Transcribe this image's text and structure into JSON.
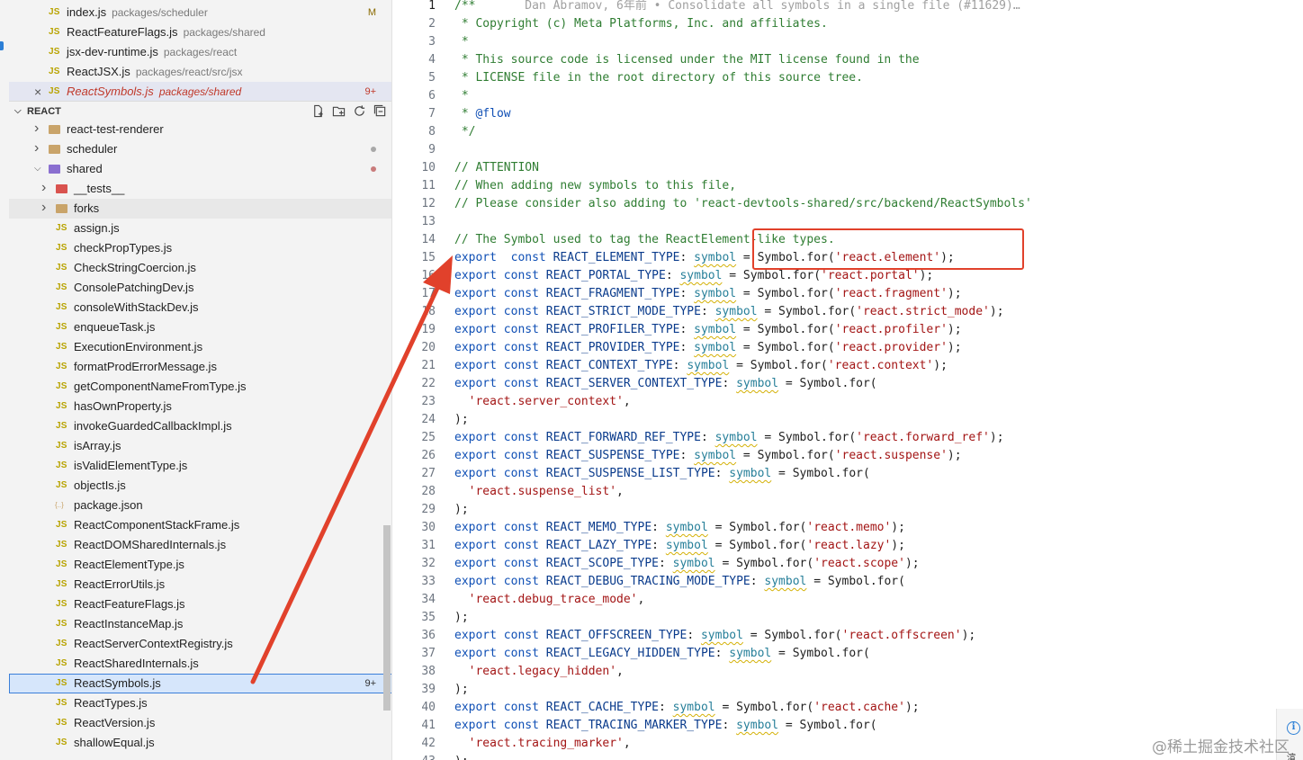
{
  "open_editors": [
    {
      "name": "index.js",
      "path": "packages/scheduler",
      "badge": "M",
      "close": false,
      "active": false
    },
    {
      "name": "ReactFeatureFlags.js",
      "path": "packages/shared",
      "badge": "",
      "close": false,
      "active": false
    },
    {
      "name": "jsx-dev-runtime.js",
      "path": "packages/react",
      "badge": "",
      "close": false,
      "active": false
    },
    {
      "name": "ReactJSX.js",
      "path": "packages/react/src/jsx",
      "badge": "",
      "close": false,
      "active": false
    },
    {
      "name": "ReactSymbols.js",
      "path": "packages/shared",
      "badge": "9+",
      "close": true,
      "active": true
    }
  ],
  "explorer": {
    "section_title": "REACT",
    "close_glyph": "×",
    "file_type_label": "JS",
    "json_type_label": "{..}",
    "folders": [
      {
        "name": "react-test-renderer",
        "expanded": false,
        "status": ""
      },
      {
        "name": "scheduler",
        "expanded": false,
        "status": "gray"
      },
      {
        "name": "shared",
        "expanded": true,
        "status": "rose"
      }
    ],
    "subfolders": [
      {
        "name": "__tests__"
      },
      {
        "name": "forks"
      }
    ],
    "files": [
      {
        "name": "assign.js",
        "type": "js"
      },
      {
        "name": "checkPropTypes.js",
        "type": "js"
      },
      {
        "name": "CheckStringCoercion.js",
        "type": "js"
      },
      {
        "name": "ConsolePatchingDev.js",
        "type": "js"
      },
      {
        "name": "consoleWithStackDev.js",
        "type": "js"
      },
      {
        "name": "enqueueTask.js",
        "type": "js"
      },
      {
        "name": "ExecutionEnvironment.js",
        "type": "js"
      },
      {
        "name": "formatProdErrorMessage.js",
        "type": "js"
      },
      {
        "name": "getComponentNameFromType.js",
        "type": "js"
      },
      {
        "name": "hasOwnProperty.js",
        "type": "js"
      },
      {
        "name": "invokeGuardedCallbackImpl.js",
        "type": "js"
      },
      {
        "name": "isArray.js",
        "type": "js"
      },
      {
        "name": "isValidElementType.js",
        "type": "js"
      },
      {
        "name": "objectIs.js",
        "type": "js"
      },
      {
        "name": "package.json",
        "type": "json"
      },
      {
        "name": "ReactComponentStackFrame.js",
        "type": "js"
      },
      {
        "name": "ReactDOMSharedInternals.js",
        "type": "js"
      },
      {
        "name": "ReactElementType.js",
        "type": "js"
      },
      {
        "name": "ReactErrorUtils.js",
        "type": "js"
      },
      {
        "name": "ReactFeatureFlags.js",
        "type": "js"
      },
      {
        "name": "ReactInstanceMap.js",
        "type": "js"
      },
      {
        "name": "ReactServerContextRegistry.js",
        "type": "js"
      },
      {
        "name": "ReactSharedInternals.js",
        "type": "js"
      },
      {
        "name": "ReactSymbols.js",
        "type": "js",
        "selected": true,
        "badge": "9+"
      },
      {
        "name": "ReactTypes.js",
        "type": "js"
      },
      {
        "name": "ReactVersion.js",
        "type": "js"
      },
      {
        "name": "shallowEqual.js",
        "type": "js"
      }
    ]
  },
  "editor": {
    "current_line": 1,
    "lines": [
      [
        [
          "cm",
          "/**"
        ],
        [
          "blame",
          "       Dan Abramov, 6年前 • Consolidate all symbols in a single file (#11629)…"
        ]
      ],
      [
        [
          "cm",
          " * Copyright (c) Meta Platforms, Inc. and affiliates."
        ]
      ],
      [
        [
          "cm",
          " *"
        ]
      ],
      [
        [
          "cm",
          " * This source code is licensed under the MIT license found in the"
        ]
      ],
      [
        [
          "cm",
          " * LICENSE file in the root directory of this source tree."
        ]
      ],
      [
        [
          "cm",
          " *"
        ]
      ],
      [
        [
          "cm",
          " * "
        ],
        [
          "an",
          "@flow"
        ]
      ],
      [
        [
          "cm",
          " */"
        ]
      ],
      [],
      [
        [
          "cm",
          "// ATTENTION"
        ]
      ],
      [
        [
          "cm",
          "// When adding new symbols to this file,"
        ]
      ],
      [
        [
          "cm",
          "// Please consider also adding to 'react-devtools-shared/src/backend/ReactSymbols'"
        ]
      ],
      [],
      [
        [
          "cm",
          "// The Symbol used to tag the ReactElement-like types."
        ]
      ],
      [
        [
          "kw",
          "export"
        ],
        [
          "",
          "  "
        ],
        [
          "kw",
          "const"
        ],
        [
          "",
          " "
        ],
        [
          "cn",
          "REACT_ELEMENT_TYPE"
        ],
        [
          "",
          ": "
        ],
        [
          "ty",
          "symbol"
        ],
        [
          "",
          " = Symbol.for("
        ],
        [
          "st",
          "'react.element'"
        ],
        [
          "",
          ");"
        ]
      ],
      [
        [
          "kw",
          "export"
        ],
        [
          "",
          " "
        ],
        [
          "kw",
          "const"
        ],
        [
          "",
          " "
        ],
        [
          "cn",
          "REACT_PORTAL_TYPE"
        ],
        [
          "",
          ": "
        ],
        [
          "ty",
          "symbol"
        ],
        [
          "",
          " = Symbol.for("
        ],
        [
          "st",
          "'react.portal'"
        ],
        [
          "",
          ");"
        ]
      ],
      [
        [
          "kw",
          "export"
        ],
        [
          "",
          " "
        ],
        [
          "kw",
          "const"
        ],
        [
          "",
          " "
        ],
        [
          "cn",
          "REACT_FRAGMENT_TYPE"
        ],
        [
          "",
          ": "
        ],
        [
          "ty",
          "symbol"
        ],
        [
          "",
          " = Symbol.for("
        ],
        [
          "st",
          "'react.fragment'"
        ],
        [
          "",
          ");"
        ]
      ],
      [
        [
          "kw",
          "export"
        ],
        [
          "",
          " "
        ],
        [
          "kw",
          "const"
        ],
        [
          "",
          " "
        ],
        [
          "cn",
          "REACT_STRICT_MODE_TYPE"
        ],
        [
          "",
          ": "
        ],
        [
          "ty",
          "symbol"
        ],
        [
          "",
          " = Symbol.for("
        ],
        [
          "st",
          "'react.strict_mode'"
        ],
        [
          "",
          ");"
        ]
      ],
      [
        [
          "kw",
          "export"
        ],
        [
          "",
          " "
        ],
        [
          "kw",
          "const"
        ],
        [
          "",
          " "
        ],
        [
          "cn",
          "REACT_PROFILER_TYPE"
        ],
        [
          "",
          ": "
        ],
        [
          "ty",
          "symbol"
        ],
        [
          "",
          " = Symbol.for("
        ],
        [
          "st",
          "'react.profiler'"
        ],
        [
          "",
          ");"
        ]
      ],
      [
        [
          "kw",
          "export"
        ],
        [
          "",
          " "
        ],
        [
          "kw",
          "const"
        ],
        [
          "",
          " "
        ],
        [
          "cn",
          "REACT_PROVIDER_TYPE"
        ],
        [
          "",
          ": "
        ],
        [
          "ty",
          "symbol"
        ],
        [
          "",
          " = Symbol.for("
        ],
        [
          "st",
          "'react.provider'"
        ],
        [
          "",
          ");"
        ]
      ],
      [
        [
          "kw",
          "export"
        ],
        [
          "",
          " "
        ],
        [
          "kw",
          "const"
        ],
        [
          "",
          " "
        ],
        [
          "cn",
          "REACT_CONTEXT_TYPE"
        ],
        [
          "",
          ": "
        ],
        [
          "ty",
          "symbol"
        ],
        [
          "",
          " = Symbol.for("
        ],
        [
          "st",
          "'react.context'"
        ],
        [
          "",
          ");"
        ]
      ],
      [
        [
          "kw",
          "export"
        ],
        [
          "",
          " "
        ],
        [
          "kw",
          "const"
        ],
        [
          "",
          " "
        ],
        [
          "cn",
          "REACT_SERVER_CONTEXT_TYPE"
        ],
        [
          "",
          ": "
        ],
        [
          "ty",
          "symbol"
        ],
        [
          "",
          " = Symbol.for("
        ]
      ],
      [
        [
          "",
          "  "
        ],
        [
          "st",
          "'react.server_context'"
        ],
        [
          "",
          ","
        ]
      ],
      [
        [
          "",
          ");"
        ]
      ],
      [
        [
          "kw",
          "export"
        ],
        [
          "",
          " "
        ],
        [
          "kw",
          "const"
        ],
        [
          "",
          " "
        ],
        [
          "cn",
          "REACT_FORWARD_REF_TYPE"
        ],
        [
          "",
          ": "
        ],
        [
          "ty",
          "symbol"
        ],
        [
          "",
          " = Symbol.for("
        ],
        [
          "st",
          "'react.forward_ref'"
        ],
        [
          "",
          ");"
        ]
      ],
      [
        [
          "kw",
          "export"
        ],
        [
          "",
          " "
        ],
        [
          "kw",
          "const"
        ],
        [
          "",
          " "
        ],
        [
          "cn",
          "REACT_SUSPENSE_TYPE"
        ],
        [
          "",
          ": "
        ],
        [
          "ty",
          "symbol"
        ],
        [
          "",
          " = Symbol.for("
        ],
        [
          "st",
          "'react.suspense'"
        ],
        [
          "",
          ");"
        ]
      ],
      [
        [
          "kw",
          "export"
        ],
        [
          "",
          " "
        ],
        [
          "kw",
          "const"
        ],
        [
          "",
          " "
        ],
        [
          "cn",
          "REACT_SUSPENSE_LIST_TYPE"
        ],
        [
          "",
          ": "
        ],
        [
          "ty",
          "symbol"
        ],
        [
          "",
          " = Symbol.for("
        ]
      ],
      [
        [
          "",
          "  "
        ],
        [
          "st",
          "'react.suspense_list'"
        ],
        [
          "",
          ","
        ]
      ],
      [
        [
          "",
          ");"
        ]
      ],
      [
        [
          "kw",
          "export"
        ],
        [
          "",
          " "
        ],
        [
          "kw",
          "const"
        ],
        [
          "",
          " "
        ],
        [
          "cn",
          "REACT_MEMO_TYPE"
        ],
        [
          "",
          ": "
        ],
        [
          "ty",
          "symbol"
        ],
        [
          "",
          " = Symbol.for("
        ],
        [
          "st",
          "'react.memo'"
        ],
        [
          "",
          ");"
        ]
      ],
      [
        [
          "kw",
          "export"
        ],
        [
          "",
          " "
        ],
        [
          "kw",
          "const"
        ],
        [
          "",
          " "
        ],
        [
          "cn",
          "REACT_LAZY_TYPE"
        ],
        [
          "",
          ": "
        ],
        [
          "ty",
          "symbol"
        ],
        [
          "",
          " = Symbol.for("
        ],
        [
          "st",
          "'react.lazy'"
        ],
        [
          "",
          ");"
        ]
      ],
      [
        [
          "kw",
          "export"
        ],
        [
          "",
          " "
        ],
        [
          "kw",
          "const"
        ],
        [
          "",
          " "
        ],
        [
          "cn",
          "REACT_SCOPE_TYPE"
        ],
        [
          "",
          ": "
        ],
        [
          "ty",
          "symbol"
        ],
        [
          "",
          " = Symbol.for("
        ],
        [
          "st",
          "'react.scope'"
        ],
        [
          "",
          ");"
        ]
      ],
      [
        [
          "kw",
          "export"
        ],
        [
          "",
          " "
        ],
        [
          "kw",
          "const"
        ],
        [
          "",
          " "
        ],
        [
          "cn",
          "REACT_DEBUG_TRACING_MODE_TYPE"
        ],
        [
          "",
          ": "
        ],
        [
          "ty",
          "symbol"
        ],
        [
          "",
          " = Symbol.for("
        ]
      ],
      [
        [
          "",
          "  "
        ],
        [
          "st",
          "'react.debug_trace_mode'"
        ],
        [
          "",
          ","
        ]
      ],
      [
        [
          "",
          ");"
        ]
      ],
      [
        [
          "kw",
          "export"
        ],
        [
          "",
          " "
        ],
        [
          "kw",
          "const"
        ],
        [
          "",
          " "
        ],
        [
          "cn",
          "REACT_OFFSCREEN_TYPE"
        ],
        [
          "",
          ": "
        ],
        [
          "ty",
          "symbol"
        ],
        [
          "",
          " = Symbol.for("
        ],
        [
          "st",
          "'react.offscreen'"
        ],
        [
          "",
          ");"
        ]
      ],
      [
        [
          "kw",
          "export"
        ],
        [
          "",
          " "
        ],
        [
          "kw",
          "const"
        ],
        [
          "",
          " "
        ],
        [
          "cn",
          "REACT_LEGACY_HIDDEN_TYPE"
        ],
        [
          "",
          ": "
        ],
        [
          "ty",
          "symbol"
        ],
        [
          "",
          " = Symbol.for("
        ]
      ],
      [
        [
          "",
          "  "
        ],
        [
          "st",
          "'react.legacy_hidden'"
        ],
        [
          "",
          ","
        ]
      ],
      [
        [
          "",
          ");"
        ]
      ],
      [
        [
          "kw",
          "export"
        ],
        [
          "",
          " "
        ],
        [
          "kw",
          "const"
        ],
        [
          "",
          " "
        ],
        [
          "cn",
          "REACT_CACHE_TYPE"
        ],
        [
          "",
          ": "
        ],
        [
          "ty",
          "symbol"
        ],
        [
          "",
          " = Symbol.for("
        ],
        [
          "st",
          "'react.cache'"
        ],
        [
          "",
          ");"
        ]
      ],
      [
        [
          "kw",
          "export"
        ],
        [
          "",
          " "
        ],
        [
          "kw",
          "const"
        ],
        [
          "",
          " "
        ],
        [
          "cn",
          "REACT_TRACING_MARKER_TYPE"
        ],
        [
          "",
          ": "
        ],
        [
          "ty",
          "symbol"
        ],
        [
          "",
          " = Symbol.for("
        ]
      ],
      [
        [
          "",
          "  "
        ],
        [
          "st",
          "'react.tracing_marker'"
        ],
        [
          "",
          ","
        ]
      ],
      [
        [
          "",
          ");"
        ]
      ]
    ]
  },
  "watermark": "@稀土掘金技术社区",
  "info_glyph": "i",
  "corner_text": "渲染",
  "colors": {
    "annotation": "#e1412b",
    "selection_outline": "#3b7fd9",
    "keyword": "#0f4fb5",
    "string": "#a31515",
    "comment": "#2f7d32"
  }
}
